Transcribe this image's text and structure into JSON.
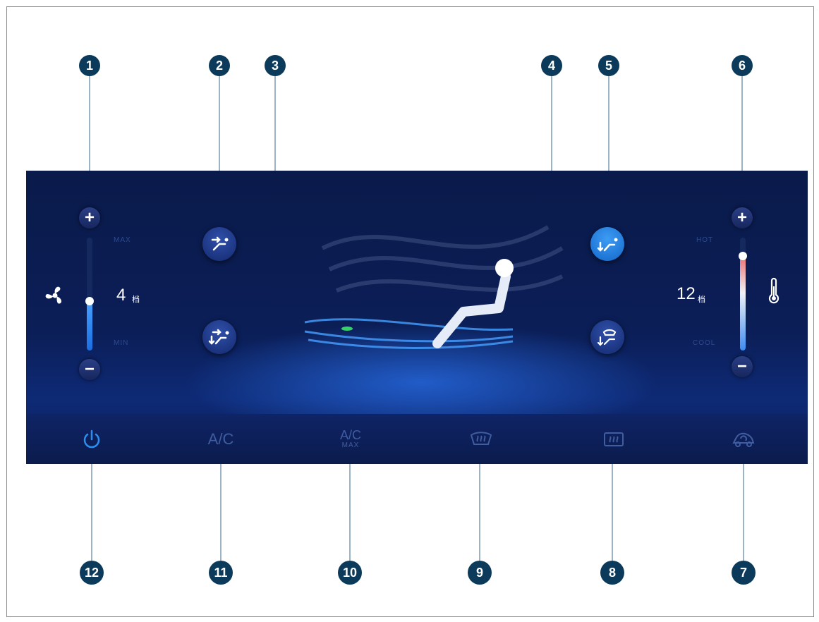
{
  "fan": {
    "value": "4",
    "unit": "档",
    "max_label": "MAX",
    "min_label": "MIN",
    "level_fraction": 0.45
  },
  "temperature": {
    "value": "12",
    "unit": "档",
    "hot_label": "HOT",
    "cool_label": "COOL",
    "level_fraction": 0.85
  },
  "bottom_bar": {
    "ac_label": "A/C",
    "acmax_top": "A/C",
    "acmax_bottom": "MAX"
  },
  "callouts": [
    "1",
    "2",
    "3",
    "4",
    "5",
    "6",
    "7",
    "8",
    "9",
    "10",
    "11",
    "12"
  ],
  "icons": {
    "power": "power-icon",
    "fan": "fan-icon",
    "thermometer": "thermometer-icon",
    "front_defrost": "front-defrost-icon",
    "rear_defrost": "rear-defrost-icon",
    "recirculation": "recirculation-icon"
  },
  "colors": {
    "accent": "#2b8ff0",
    "callout": "#0b3a5a",
    "panel": "#0b1e57",
    "inactive_text": "#3f5d9f"
  }
}
